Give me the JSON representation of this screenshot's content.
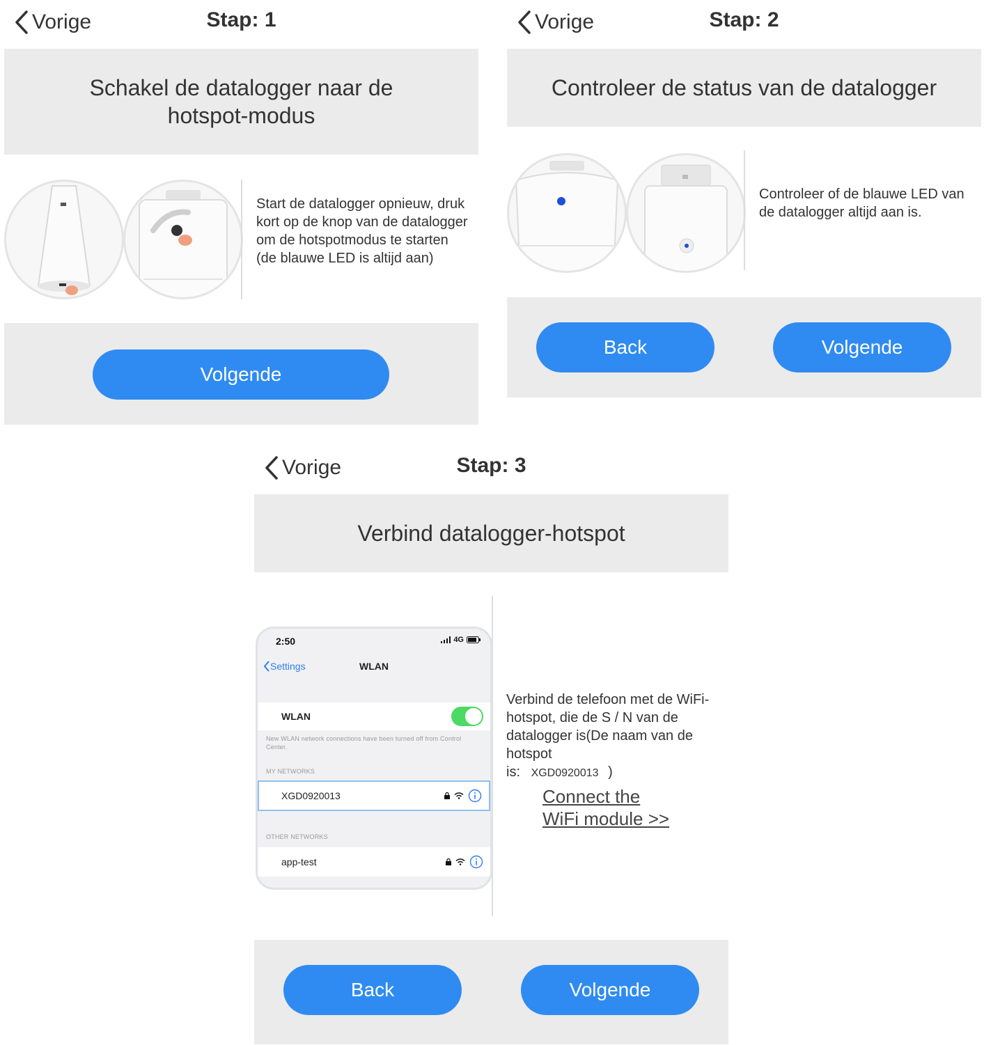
{
  "step1": {
    "back_label": "Vorige",
    "step_label": "Stap: 1",
    "title_line1": "Schakel de datalogger naar de",
    "title_line2": "hotspot-modus",
    "description": "Start de datalogger opnieuw, druk kort op de knop van de datalogger om de hotspotmodus te starten (de blauwe LED is altijd aan)",
    "next_label": "Volgende"
  },
  "step2": {
    "back_label": "Vorige",
    "step_label": "Stap: 2",
    "title": "Controleer de status van de datalogger",
    "description": "Controleer of de blauwe LED van de datalogger altijd aan is.",
    "back_button_label": "Back",
    "next_label": "Volgende"
  },
  "step3": {
    "back_label": "Vorige",
    "step_label": "Stap: 3",
    "title": "Verbind datalogger-hotspot",
    "description": "Verbind de telefoon met de WiFi-hotspot, die de S / N van de datalogger is(De naam van de hotspot",
    "hotspot_prefix": "is:",
    "hotspot_name": "XGD0920013",
    "hotspot_suffix": ")",
    "link_line1": "Connect the",
    "link_line2": "WiFi module >>",
    "back_button_label": "Back",
    "next_label": "Volgende",
    "phone": {
      "time": "2:50",
      "network": "4G",
      "nav_back": "Settings",
      "nav_title": "WLAN",
      "wlan_label": "WLAN",
      "wlan_on": true,
      "notice": "New WLAN network connections have been turned off from Control Center.",
      "my_networks_header": "MY NETWORKS",
      "my_network": "XGD0920013",
      "other_networks_header": "OTHER NETWORKS",
      "other_network": "app-test"
    }
  },
  "colors": {
    "accent": "#2f8bf1",
    "panel_bg": "#ebebeb",
    "led_blue": "#1f4fd6",
    "toggle_green": "#4cd964"
  }
}
